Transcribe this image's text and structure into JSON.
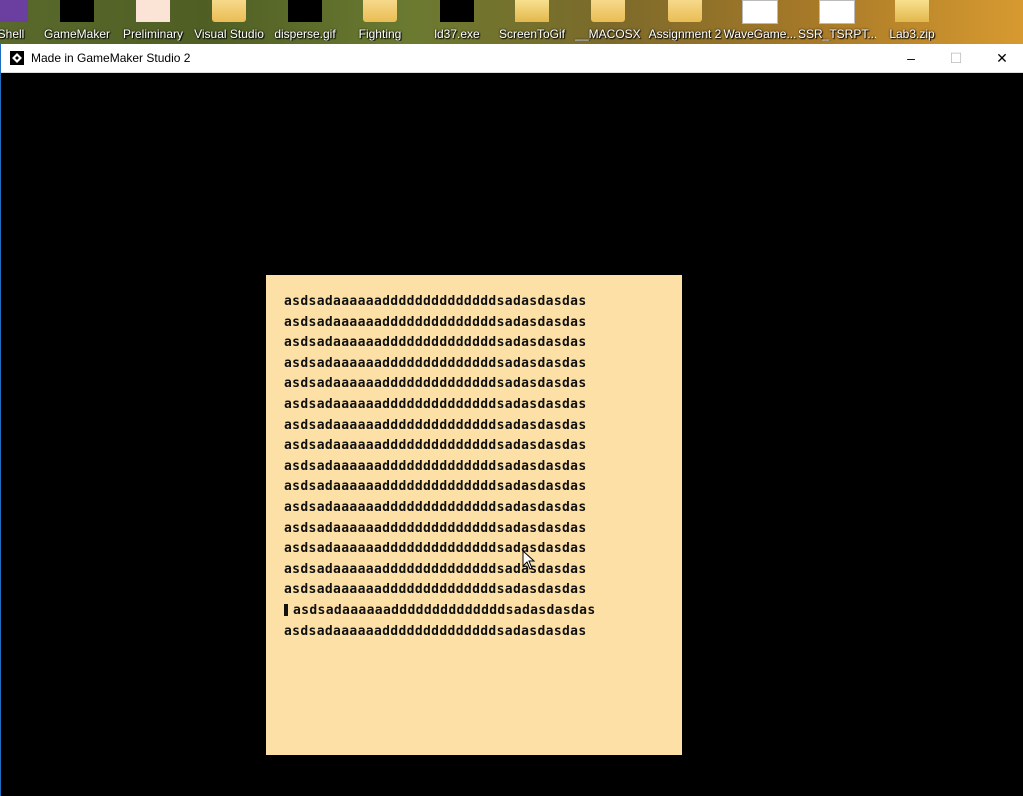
{
  "desktop": {
    "icons": [
      {
        "label": "Shell",
        "icon": "powershell-icon"
      },
      {
        "label": "GameMaker",
        "icon": "gamemaker-icon"
      },
      {
        "label": "Preliminary",
        "icon": "powerpoint-icon"
      },
      {
        "label": "Visual Studio",
        "icon": "folder-icon"
      },
      {
        "label": "disperse.gif",
        "icon": "gif-icon"
      },
      {
        "label": "Fighting",
        "icon": "shield-shortcut-icon"
      },
      {
        "label": "ld37.exe",
        "icon": "gamemaker-icon"
      },
      {
        "label": "ScreenToGif",
        "icon": "zip-icon"
      },
      {
        "label": "__MACOSX",
        "icon": "folder-icon"
      },
      {
        "label": "Assignment 2",
        "icon": "folder-icon"
      },
      {
        "label": "WaveGame...",
        "icon": "document-icon"
      },
      {
        "label": "SSR_TSRPT...",
        "icon": "pdf-icon"
      },
      {
        "label": "Lab3.zip",
        "icon": "zip-icon"
      }
    ]
  },
  "window": {
    "title": "Made in GameMaker Studio 2",
    "minimize_glyph": "–",
    "maximize_glyph": "☐",
    "close_glyph": "✕"
  },
  "game": {
    "lines": [
      "asdsadaaaaaaddddddddddddddsadasdasdas",
      "asdsadaaaaaaddddddddddddddsadasdasdas",
      "asdsadaaaaaaddddddddddddddsadasdasdas",
      "asdsadaaaaaaddddddddddddddsadasdasdas",
      "asdsadaaaaaaddddddddddddddsadasdasdas",
      "asdsadaaaaaaddddddddddddddsadasdasdas",
      "asdsadaaaaaaddddddddddddddsadasdasdas",
      "asdsadaaaaaaddddddddddddddsadasdasdas",
      "asdsadaaaaaaddddddddddddddsadasdasdas",
      "asdsadaaaaaaddddddddddddddsadasdasdas",
      "asdsadaaaaaaddddddddddddddsadasdasdas",
      "asdsadaaaaaaddddddddddddddsadasdasdas",
      "asdsadaaaaaaddddddddddddddsadasdasdas",
      "asdsadaaaaaaddddddddddddddsadasdasdas",
      "asdsadaaaaaaddddddddddddddsadasdasdas",
      "asdsadaaaaaaddddddddddddddsadasdasdas",
      "asdsadaaaaaaddddddddddddddsadasdasdas"
    ],
    "caret_line": 15,
    "box_color": "#fde0a6"
  }
}
